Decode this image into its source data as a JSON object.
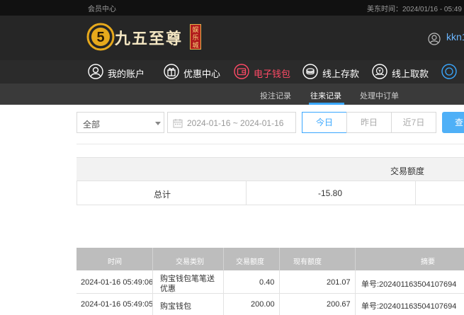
{
  "topbar": {
    "member_center": "会员中心",
    "time_text": "美东时间：2024/01/16 - 05:49"
  },
  "header": {
    "brand_name": "九五至尊",
    "brand_seal": "娱乐城",
    "brand_numeral": "5",
    "username": "kkn1",
    "colors": {
      "accent_gold": "#e7a91c",
      "accent_blue": "#39a7ff",
      "active_nav": "#ff4a66"
    }
  },
  "nav": {
    "items": [
      {
        "label": "我的账户",
        "icon": "user-circle-icon"
      },
      {
        "label": "优惠中心",
        "icon": "gift-icon"
      },
      {
        "label": "电子钱包",
        "icon": "wallet-icon",
        "active": true
      },
      {
        "label": "线上存款",
        "icon": "deposit-icon"
      },
      {
        "label": "线上取款",
        "icon": "withdraw-icon"
      },
      {
        "label": "",
        "icon": "more-icon"
      }
    ]
  },
  "subnav": {
    "items": [
      {
        "label": "投注记录"
      },
      {
        "label": "往来记录",
        "active": true
      },
      {
        "label": "处理中订单"
      }
    ]
  },
  "filters": {
    "type_select": "全部",
    "date_range": "2024-01-16 ~ 2024-01-16",
    "quick": [
      "今日",
      "昨日",
      "近7日"
    ],
    "search_label": "查询"
  },
  "summary": {
    "header": "交易额度",
    "label": "总计",
    "amount": "-15.80"
  },
  "table": {
    "columns": [
      "时间",
      "交易类别",
      "交易额度",
      "现有额度",
      "摘要"
    ],
    "rows": [
      {
        "time": "2024-01-16 05:49:06",
        "category": [
          "购宝钱包笔笔送",
          "优惠"
        ],
        "amount": "0.40",
        "balance": "201.07",
        "summary": "单号:202401163504107694"
      },
      {
        "time": "2024-01-16 05:49:05",
        "category": [
          "购宝钱包",
          ""
        ],
        "amount": "200.00",
        "balance": "200.67",
        "summary": "单号:202401163504107694"
      }
    ]
  }
}
